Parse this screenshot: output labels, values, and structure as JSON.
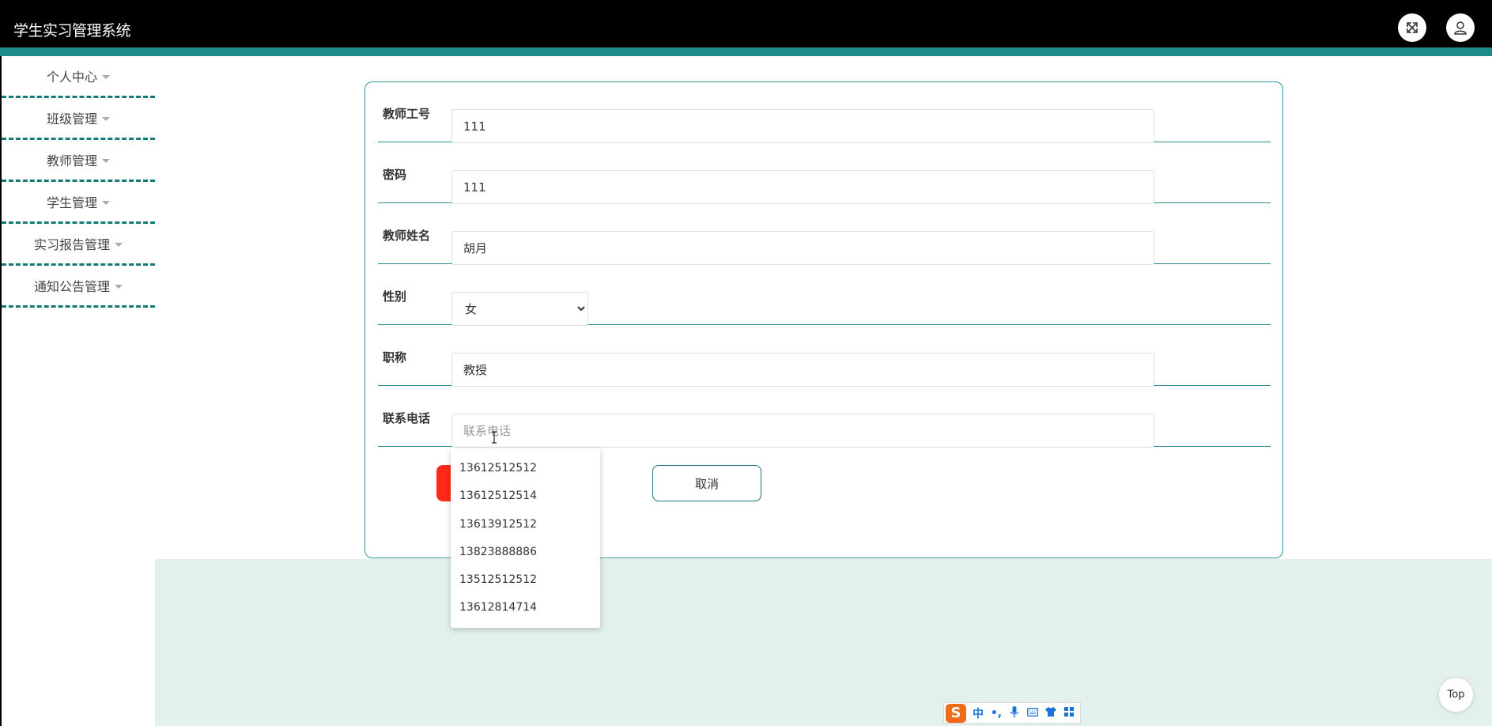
{
  "header": {
    "app_title": "学生实习管理系统"
  },
  "sidebar": {
    "items": [
      {
        "label": "个人中心"
      },
      {
        "label": "班级管理"
      },
      {
        "label": "教师管理"
      },
      {
        "label": "学生管理"
      },
      {
        "label": "实习报告管理"
      },
      {
        "label": "通知公告管理"
      }
    ]
  },
  "form": {
    "teacher_id": {
      "label": "教师工号",
      "value": "111"
    },
    "password": {
      "label": "密码",
      "value": "111"
    },
    "teacher_name": {
      "label": "教师姓名",
      "value": "胡月"
    },
    "gender": {
      "label": "性别",
      "selected": "女"
    },
    "title": {
      "label": "职称",
      "value": "教授"
    },
    "phone": {
      "label": "联系电话",
      "value": "",
      "placeholder": "联系电话"
    },
    "cancel_label": "取消"
  },
  "autocomplete": {
    "options": [
      "13612512512",
      "13612512514",
      "13613912512",
      "13823888886",
      "13512512512",
      "13612814714"
    ]
  },
  "top_button_label": "Top",
  "ime": {
    "logo": "S",
    "mode": "中",
    "punct": "•,",
    "icons": [
      "microphone-icon",
      "keyboard-icon",
      "shirt-icon",
      "grid-icon"
    ]
  },
  "colors": {
    "header_bg": "#000000",
    "accent": "#1e8a8a",
    "submit": "#ff2a1a",
    "content_bg": "#e3f1ed"
  }
}
